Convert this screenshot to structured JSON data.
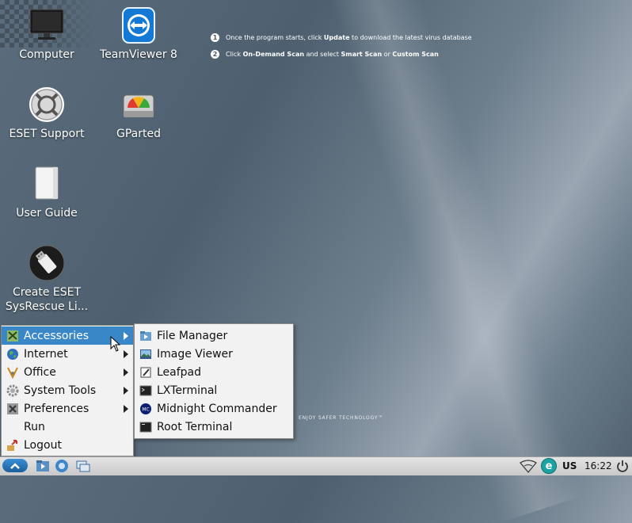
{
  "desktop": {
    "icons": [
      {
        "label": "Computer"
      },
      {
        "label": "TeamViewer 8"
      },
      {
        "label": "ESET Support"
      },
      {
        "label": "GParted"
      },
      {
        "label": "User Guide"
      },
      {
        "label": "Create ESET SysRescue Li..."
      }
    ],
    "instructions": [
      {
        "num": "1",
        "pre": "Once the program starts, click ",
        "bold": "Update",
        "post": " to download the latest virus database"
      },
      {
        "num": "2",
        "pre": "Click ",
        "bold": "On-Demand Scan",
        "mid": " and select ",
        "bold2": "Smart Scan",
        "or": " or ",
        "bold3": "Custom Scan"
      }
    ],
    "tagline": "ENJOY SAFER TECHNOLOGY™"
  },
  "main_menu": {
    "items": [
      {
        "label": "Accessories",
        "icon": "accessories-icon",
        "submenu": true,
        "selected": true
      },
      {
        "label": "Internet",
        "icon": "internet-globe-icon",
        "submenu": true
      },
      {
        "label": "Office",
        "icon": "office-icon",
        "submenu": true
      },
      {
        "label": "System Tools",
        "icon": "system-tools-gear-icon",
        "submenu": true
      },
      {
        "label": "Preferences",
        "icon": "preferences-icon",
        "submenu": true
      },
      {
        "label": "Run",
        "icon": "",
        "submenu": false
      },
      {
        "label": "Logout",
        "icon": "logout-icon",
        "submenu": false
      }
    ]
  },
  "accessories_menu": {
    "items": [
      {
        "label": "File Manager",
        "icon": "file-manager-icon"
      },
      {
        "label": "Image Viewer",
        "icon": "image-viewer-icon"
      },
      {
        "label": "Leafpad",
        "icon": "leafpad-icon"
      },
      {
        "label": "LXTerminal",
        "icon": "terminal-icon"
      },
      {
        "label": "Midnight Commander",
        "icon": "midnight-commander-icon"
      },
      {
        "label": "Root Terminal",
        "icon": "root-terminal-icon"
      }
    ]
  },
  "taskbar": {
    "keyboard_layout": "US",
    "clock": "16:22"
  },
  "colors": {
    "menu_selection": "#3a87c7",
    "menu_bg": "#f2f2f2",
    "eset_teal": "#1aa3a0"
  }
}
